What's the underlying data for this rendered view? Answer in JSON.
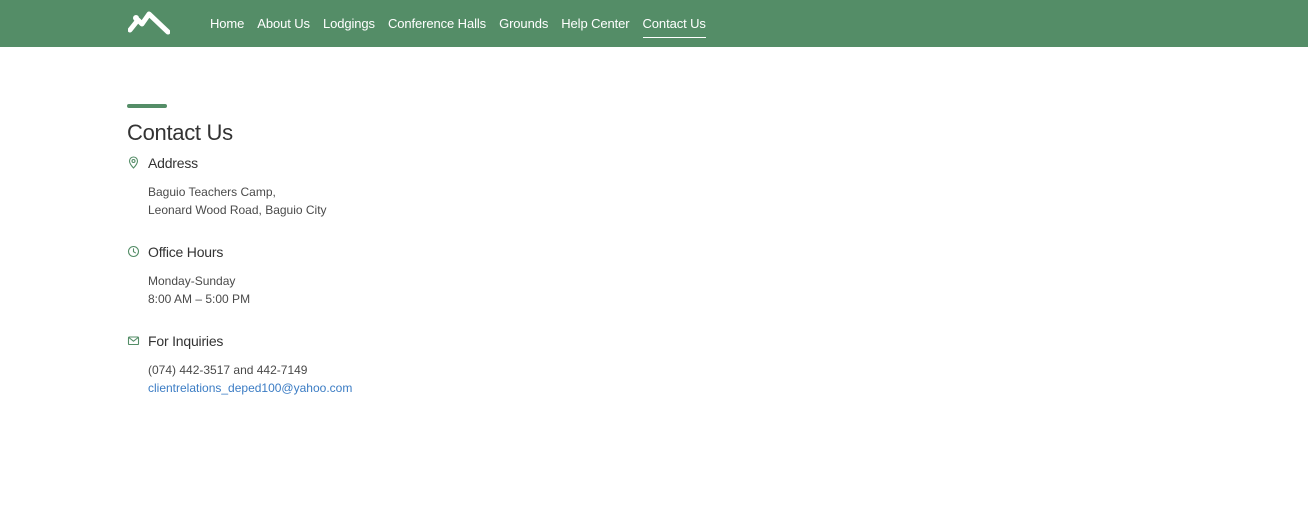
{
  "nav": {
    "logo": "house-logo-icon",
    "items": [
      {
        "label": "Home"
      },
      {
        "label": "About Us"
      },
      {
        "label": "Lodgings"
      },
      {
        "label": "Conference Halls"
      },
      {
        "label": "Grounds"
      },
      {
        "label": "Help Center"
      },
      {
        "label": "Contact Us",
        "active": true
      }
    ]
  },
  "page": {
    "title": "Contact Us"
  },
  "sections": {
    "address": {
      "icon": "map-pin-icon",
      "title": "Address",
      "line1": "Baguio Teachers Camp,",
      "line2": "Leonard Wood Road, Baguio City"
    },
    "hours": {
      "icon": "clock-icon",
      "title": "Office Hours",
      "line1": "Monday-Sunday",
      "line2": "8:00 AM – 5:00 PM"
    },
    "inquiries": {
      "icon": "mail-icon",
      "title": "For Inquiries",
      "phone": "(074) 442-3517 and 442-7149",
      "email": "clientrelations_deped100@yahoo.com"
    }
  },
  "colors": {
    "brand": "#548d67",
    "link": "#3b7cc4",
    "text": "#333333"
  }
}
